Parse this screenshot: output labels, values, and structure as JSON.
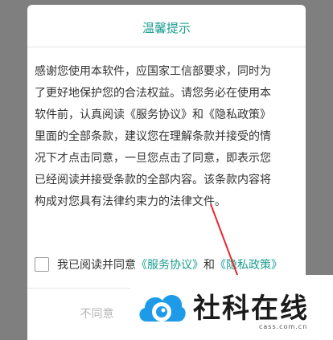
{
  "dialog": {
    "title": "温馨提示",
    "body_lines": [
      "感谢您使用本软件，应国家工信部要求，同时为",
      "了更好地保护您的合法权益。请您务必在使用本",
      "软件前，认真阅读《服务协议》和《隐私政策》",
      "里面的全部条款，建议您在理解条款并接受的情",
      "况下才点击同意，一旦您点击了同意，即表示您",
      "已经阅读并接受条款的全部内容。该条款内容将",
      "构成对您具有法律约束力的法律文件。"
    ],
    "agree": {
      "prefix": "我已阅读并同意",
      "service_link": "《服务协议》",
      "conjunction": "和",
      "privacy_link": "《隐私政策》"
    },
    "buttons": {
      "disagree": "不同意"
    }
  },
  "watermark": {
    "name": "社科在线",
    "url": "cass.com.cn"
  },
  "colors": {
    "overlay": "#7f7f7f",
    "accent": "#1a9e8f",
    "arrow": "#e8262c",
    "logo_blue": "#1e9be8"
  }
}
